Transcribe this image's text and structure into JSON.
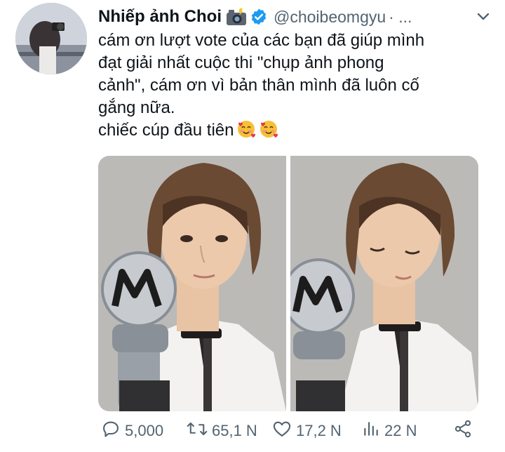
{
  "tweet": {
    "display_name": "Nhiếp ảnh Choi",
    "handle": "@choibeomgyu",
    "separator": "· ...",
    "text_lines": [
      "cám ơn lượt vote của các bạn đã giúp mình",
      "đạt giải nhất cuộc thi \"chụp ảnh phong",
      "cảnh\", cám ơn vì bản thân mình đã luôn cố",
      "gắng nữa.",
      "chiếc cúp đầu tiên"
    ]
  },
  "icons": {
    "name_emoji": "camera-flash-icon",
    "verified": "verified-badge-icon",
    "more": "chevron-down-icon",
    "text_emoji": "smiling-face-with-hearts-icon",
    "reply": "reply-icon",
    "retweet": "retweet-icon",
    "like": "heart-icon",
    "views": "views-icon",
    "share": "share-icon"
  },
  "actions": {
    "replies": "5,000",
    "retweets": "65,1 N",
    "likes": "17,2 N",
    "views": "22 N"
  },
  "colors": {
    "text": "#0f1419",
    "secondary": "#536471",
    "verified": "#1d9bf0"
  }
}
